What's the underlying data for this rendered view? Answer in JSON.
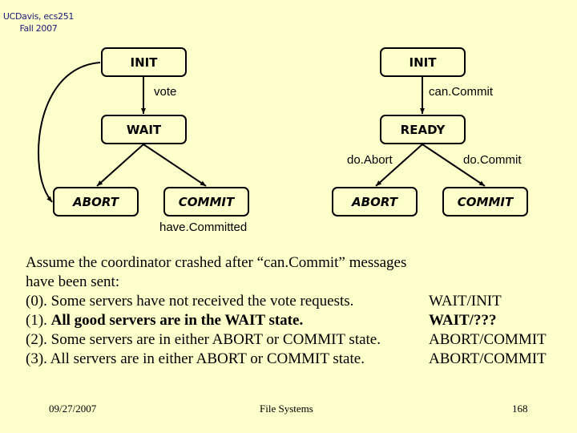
{
  "header": {
    "line1": "UCDavis, ecs251",
    "line2": "Fall 2007"
  },
  "diagram": {
    "coordinator": {
      "states": {
        "init": "INIT",
        "wait": "WAIT",
        "abort": "ABORT",
        "commit": "COMMIT"
      },
      "edges": {
        "vote": "vote"
      }
    },
    "participant": {
      "states": {
        "init": "INIT",
        "ready": "READY",
        "abort": "ABORT",
        "commit": "COMMIT"
      },
      "edges": {
        "can_commit": "can.Commit",
        "do_abort": "do.Abort",
        "do_commit": "do.Commit"
      }
    },
    "have_committed": "have.Committed"
  },
  "body": {
    "intro_line1": "Assume the coordinator crashed after “can.Commit” messages",
    "intro_line2": "have been sent:",
    "cases": [
      {
        "prefix": "(0). ",
        "text": "Some servers have not received the vote requests.",
        "answer": "WAIT/INIT",
        "bold": false
      },
      {
        "prefix": "(1). ",
        "text": "All good servers are in the WAIT state.",
        "answer": "WAIT/???",
        "bold": true
      },
      {
        "prefix": "(2). ",
        "text": "Some servers are in either ABORT or COMMIT state.",
        "answer": "ABORT/COMMIT",
        "bold": false
      },
      {
        "prefix": "(3). ",
        "text": "All servers are in either ABORT or COMMIT state.",
        "answer": "ABORT/COMMIT",
        "bold": false
      }
    ]
  },
  "footer": {
    "date": "09/27/2007",
    "title": "File Systems",
    "page": "168"
  }
}
